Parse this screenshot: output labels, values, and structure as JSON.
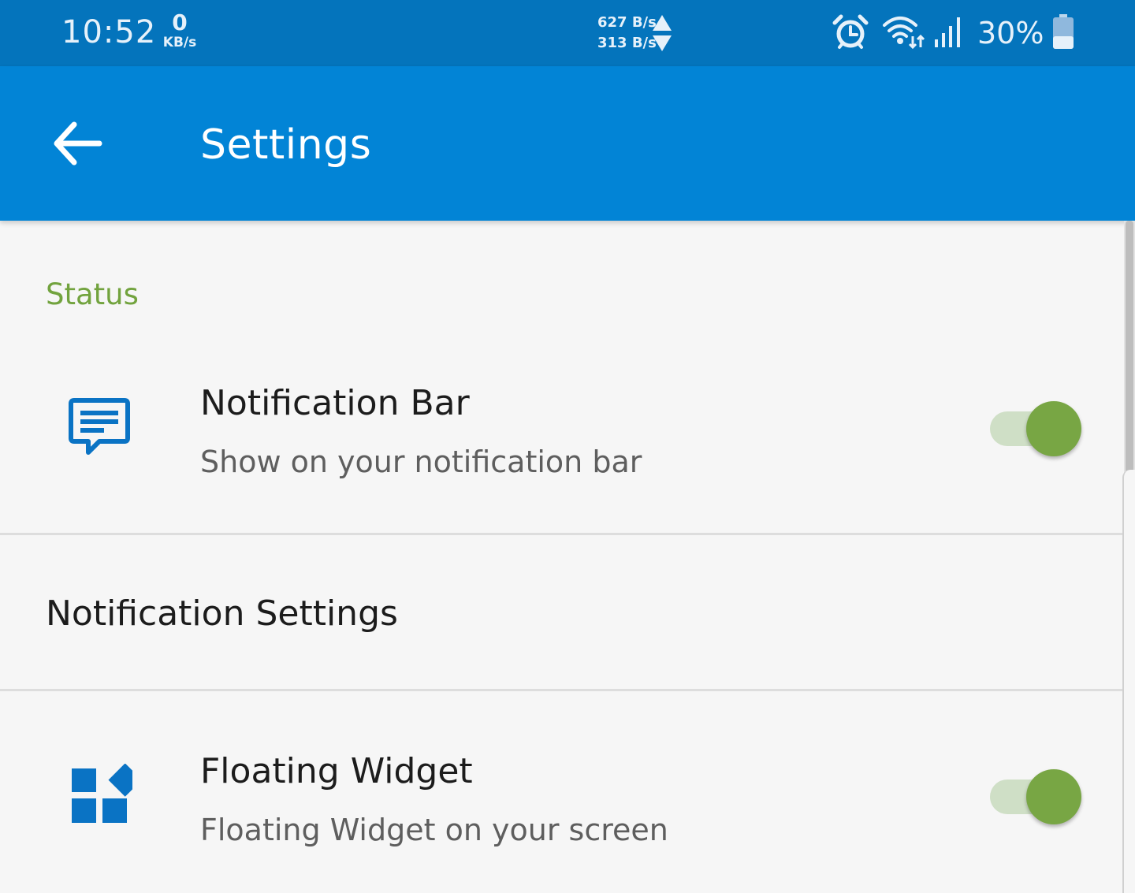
{
  "status_bar": {
    "time": "10:52",
    "net_speed_value": "0",
    "net_speed_unit": "KB/s",
    "upload_speed": "627 B/s",
    "download_speed": "313 B/s",
    "icons": [
      "alarm-icon",
      "wifi-icon",
      "signal-icon",
      "battery-icon"
    ],
    "battery_percent": "30%"
  },
  "app_bar": {
    "back_icon": "arrow-left-icon",
    "title": "Settings"
  },
  "sections": {
    "status_header": "Status"
  },
  "prefs": {
    "notification_bar": {
      "icon": "message-icon",
      "title": "Notification Bar",
      "summary": "Show on your notification bar",
      "enabled": true
    },
    "notification_settings": {
      "title": "Notification Settings"
    },
    "floating_widget": {
      "icon": "widgets-icon",
      "title": "Floating Widget",
      "summary": "Floating Widget on your screen",
      "enabled": true
    }
  },
  "colors": {
    "status_bar_bg": "#0474bc",
    "app_bar_bg": "#0284d6",
    "accent_green": "#78a644",
    "section_header_green": "#72a33e",
    "icon_blue": "#0a73c4",
    "background": "#f6f6f6"
  }
}
